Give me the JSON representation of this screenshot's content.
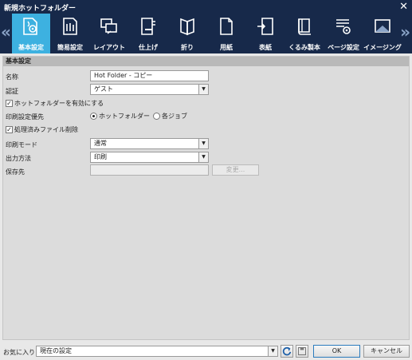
{
  "window": {
    "title": "新規ホットフォルダー"
  },
  "toolbar": {
    "items": [
      {
        "label": "基本設定",
        "icon": "basic-settings-icon"
      },
      {
        "label": "簡易設定",
        "icon": "easy-settings-icon"
      },
      {
        "label": "レイアウト",
        "icon": "layout-icon"
      },
      {
        "label": "仕上げ",
        "icon": "finishing-icon"
      },
      {
        "label": "折り",
        "icon": "fold-icon"
      },
      {
        "label": "用紙",
        "icon": "paper-icon"
      },
      {
        "label": "表紙",
        "icon": "cover-icon"
      },
      {
        "label": "くるみ製本",
        "icon": "perfect-binding-icon"
      },
      {
        "label": "ページ設定",
        "icon": "page-settings-icon"
      },
      {
        "label": "イメージング",
        "icon": "imaging-icon"
      }
    ],
    "active_index": 0
  },
  "section": {
    "title": "基本設定"
  },
  "form": {
    "name_label": "名称",
    "name_value": "Hot Folder - コピー",
    "auth_label": "認証",
    "auth_value": "ゲスト",
    "enable_label": "ホットフォルダーを有効にする",
    "priority_label": "印刷設定優先",
    "priority_opt1": "ホットフォルダー",
    "priority_opt2": "各ジョブ",
    "delete_label": "処理済みファイル削除",
    "print_mode_label": "印刷モード",
    "print_mode_value": "通常",
    "output_label": "出力方法",
    "output_value": "印刷",
    "save_label": "保存先",
    "save_value": "",
    "change_button": "変更..."
  },
  "footer": {
    "favorites_label": "お気に入り",
    "favorites_value": "現在の設定",
    "ok_button": "OK",
    "cancel_button": "キャンセル"
  }
}
